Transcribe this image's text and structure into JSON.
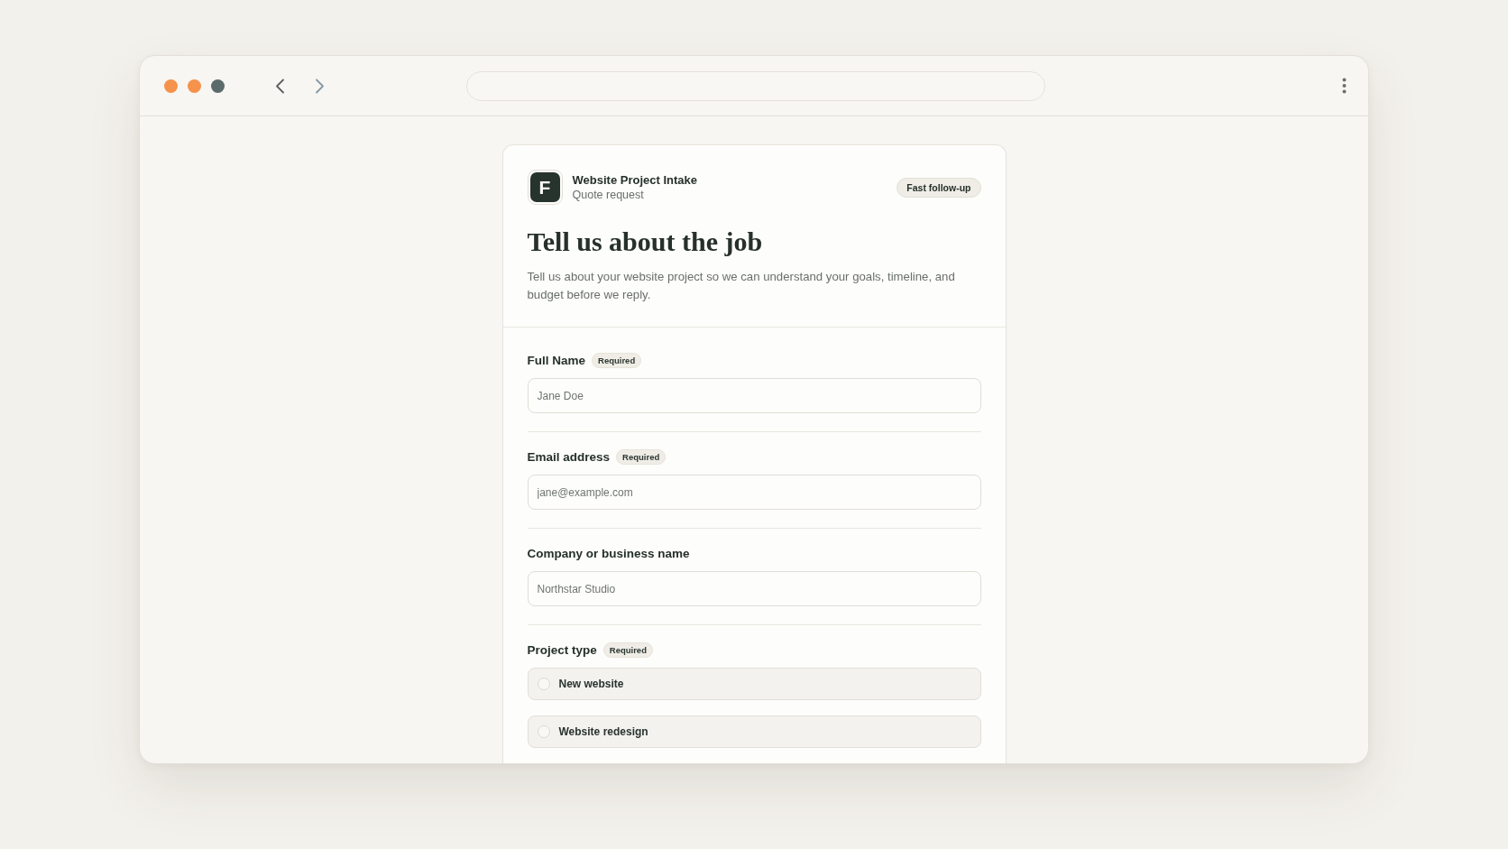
{
  "browser": {
    "back": {
      "disabled": false
    },
    "forward": {
      "disabled": true
    }
  },
  "form": {
    "logo": "F",
    "title": "Website Project Intake",
    "subtitle": "Quote request",
    "badge": "Fast follow-up",
    "heading": "Tell us about the job",
    "intro": "Tell us about your website project so we can understand your goals, timeline, and budget before we reply.",
    "fields": [
      {
        "kind": "text",
        "label": "Full Name",
        "tag": "Required",
        "placeholder": "Jane Doe"
      },
      {
        "kind": "text",
        "label": "Email address",
        "tag": "Required",
        "placeholder": "jane@example.com"
      },
      {
        "kind": "text",
        "label": "Company or business name",
        "placeholder": "Northstar Studio"
      },
      {
        "kind": "choice",
        "label": "Project type",
        "tag": "Required",
        "options": [
          {
            "label": "New website",
            "selected": false
          },
          {
            "label": "Website redesign",
            "selected": false
          }
        ]
      }
    ]
  }
}
